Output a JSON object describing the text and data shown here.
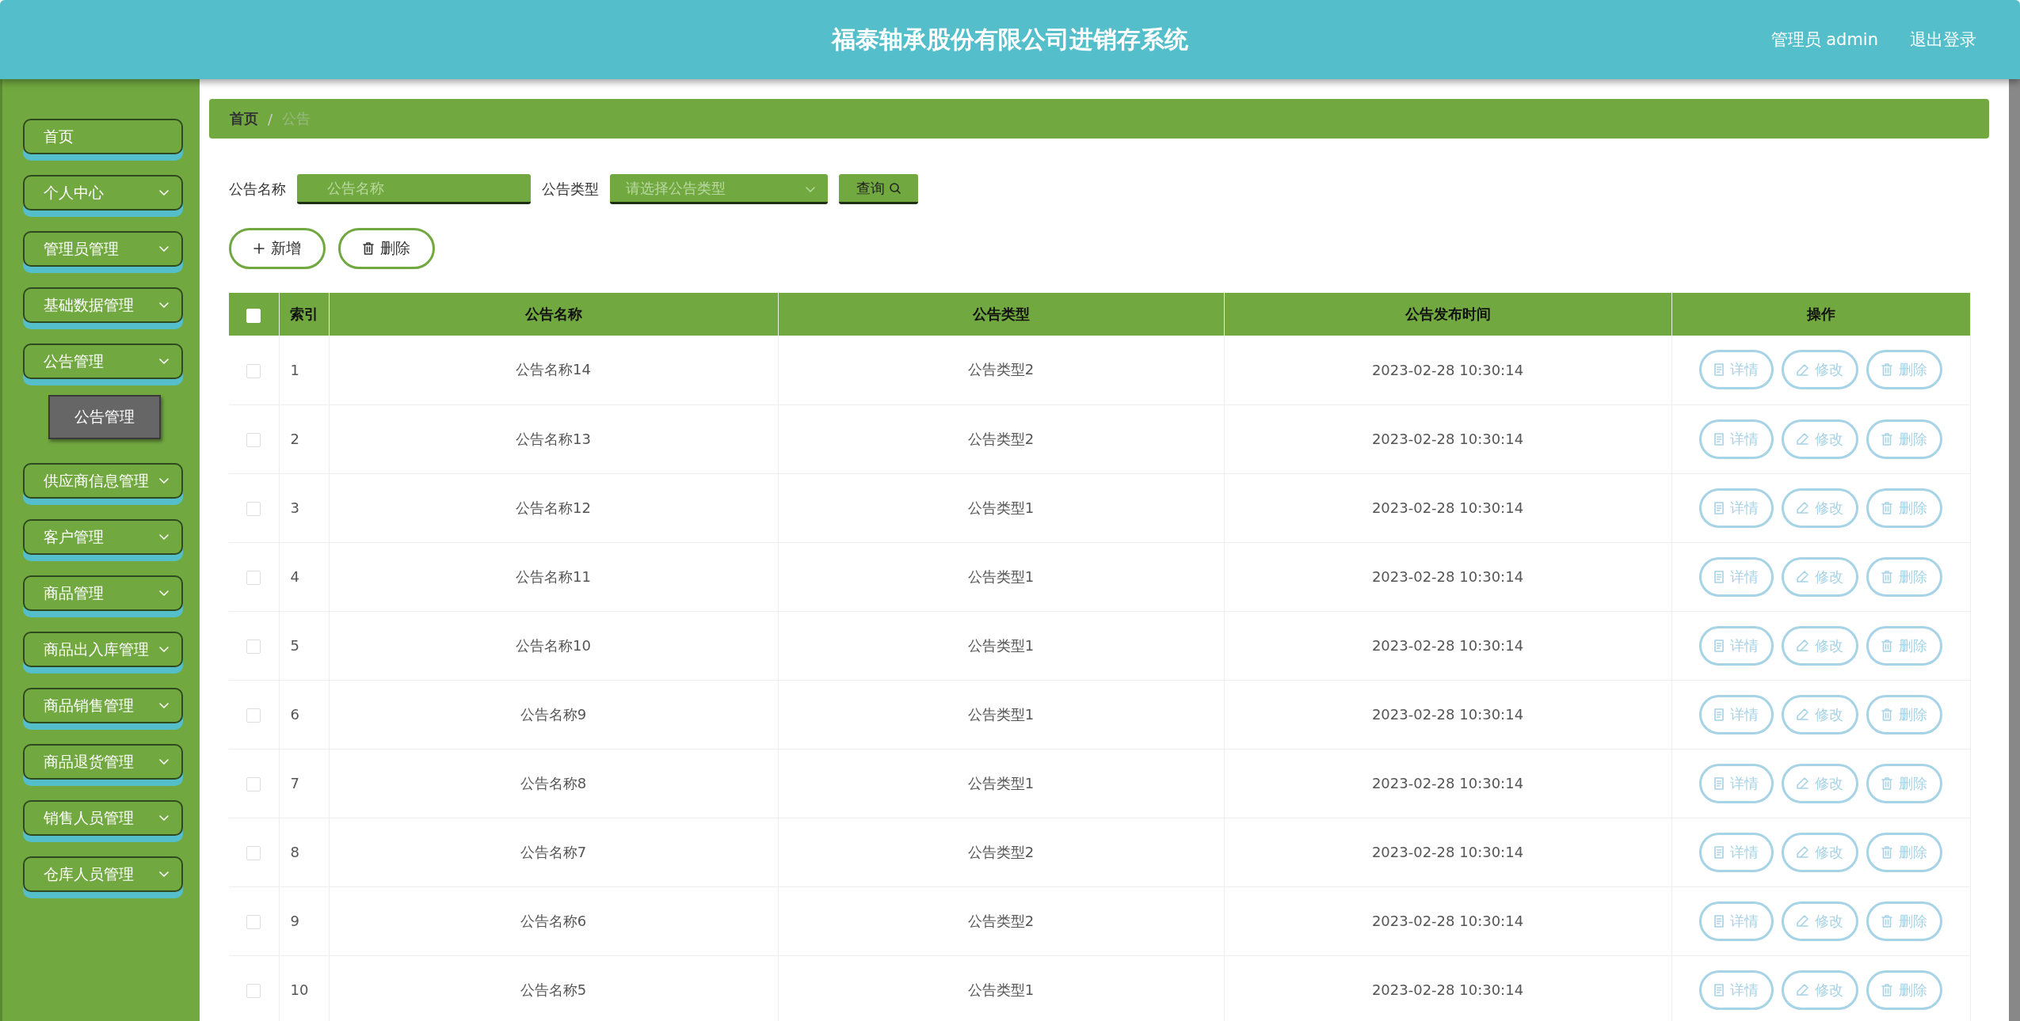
{
  "header": {
    "title": "福泰轴承股份有限公司进销存系统",
    "user": "管理员 admin",
    "logout": "退出登录"
  },
  "sidebar": {
    "items": [
      {
        "label": "首页",
        "kind": "link"
      },
      {
        "label": "个人中心",
        "kind": "menu"
      },
      {
        "label": "管理员管理",
        "kind": "menu"
      },
      {
        "label": "基础数据管理",
        "kind": "menu"
      },
      {
        "label": "公告管理",
        "kind": "menu",
        "children": [
          {
            "label": "公告管理",
            "selected": true
          }
        ]
      },
      {
        "label": "供应商信息管理",
        "kind": "menu"
      },
      {
        "label": "客户管理",
        "kind": "menu"
      },
      {
        "label": "商品管理",
        "kind": "menu"
      },
      {
        "label": "商品出入库管理",
        "kind": "menu"
      },
      {
        "label": "商品销售管理",
        "kind": "menu"
      },
      {
        "label": "商品退货管理",
        "kind": "menu"
      },
      {
        "label": "销售人员管理",
        "kind": "menu"
      },
      {
        "label": "仓库人员管理",
        "kind": "menu"
      }
    ]
  },
  "breadcrumb": {
    "home": "首页",
    "separator": "/",
    "current": "公告"
  },
  "search": {
    "name_label": "公告名称",
    "name_placeholder": "公告名称",
    "type_label": "公告类型",
    "type_placeholder": "请选择公告类型",
    "query_button": "查询"
  },
  "actions": {
    "add": "新增",
    "delete": "删除"
  },
  "table": {
    "columns": [
      "索引",
      "公告名称",
      "公告类型",
      "公告发布时间",
      "操作"
    ],
    "header_checked": false,
    "rows": [
      {
        "index": "1",
        "name": "公告名称14",
        "type": "公告类型2",
        "time": "2023-02-28 10:30:14",
        "checked": false,
        "actions": [
          "详情",
          "修改",
          "删除"
        ]
      },
      {
        "index": "2",
        "name": "公告名称13",
        "type": "公告类型2",
        "time": "2023-02-28 10:30:14",
        "checked": false,
        "actions": [
          "详情",
          "修改",
          "删除"
        ]
      },
      {
        "index": "3",
        "name": "公告名称12",
        "type": "公告类型1",
        "time": "2023-02-28 10:30:14",
        "checked": false,
        "actions": [
          "详情",
          "修改",
          "删除"
        ]
      },
      {
        "index": "4",
        "name": "公告名称11",
        "type": "公告类型1",
        "time": "2023-02-28 10:30:14",
        "checked": false,
        "actions": [
          "详情",
          "修改",
          "删除"
        ]
      },
      {
        "index": "5",
        "name": "公告名称10",
        "type": "公告类型1",
        "time": "2023-02-28 10:30:14",
        "checked": false,
        "actions": [
          "详情",
          "修改",
          "删除"
        ]
      },
      {
        "index": "6",
        "name": "公告名称9",
        "type": "公告类型1",
        "time": "2023-02-28 10:30:14",
        "checked": false,
        "actions": [
          "详情",
          "修改",
          "删除"
        ]
      },
      {
        "index": "7",
        "name": "公告名称8",
        "type": "公告类型1",
        "time": "2023-02-28 10:30:14",
        "checked": false,
        "actions": [
          "详情",
          "修改",
          "删除"
        ]
      },
      {
        "index": "8",
        "name": "公告名称7",
        "type": "公告类型2",
        "time": "2023-02-28 10:30:14",
        "checked": false,
        "actions": [
          "详情",
          "修改",
          "删除"
        ]
      },
      {
        "index": "9",
        "name": "公告名称6",
        "type": "公告类型2",
        "time": "2023-02-28 10:30:14",
        "checked": false,
        "actions": [
          "详情",
          "修改",
          "删除"
        ]
      },
      {
        "index": "10",
        "name": "公告名称5",
        "type": "公告类型1",
        "time": "2023-02-28 10:30:14",
        "checked": false,
        "actions": [
          "详情",
          "修改",
          "删除"
        ]
      }
    ]
  }
}
